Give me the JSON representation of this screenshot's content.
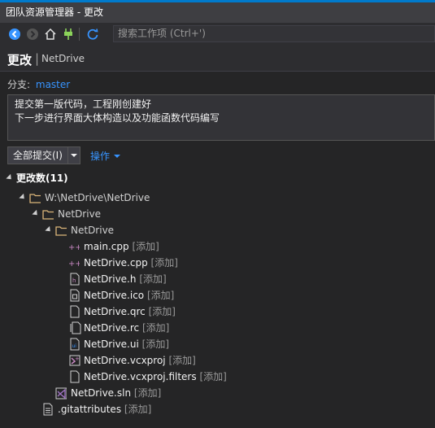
{
  "window": {
    "title": "团队资源管理器 - 更改"
  },
  "toolbar": {
    "search_placeholder": "搜索工作项 (Ctrl+')"
  },
  "header": {
    "title": "更改",
    "subtitle": "NetDrive"
  },
  "branch": {
    "label": "分支:",
    "name": "master"
  },
  "commit_message": {
    "line1": "提交第一版代码，工程刚创建好",
    "line2": "下一步进行界面大体构造以及功能函数代码编写"
  },
  "buttons": {
    "commit_all": "全部提交(I)",
    "actions": "操作"
  },
  "changes": {
    "section_label": "更改数(11)",
    "path": "W:\\NetDrive\\NetDrive",
    "folder1": "NetDrive",
    "folder2": "NetDrive",
    "files": [
      {
        "name": "main.cpp",
        "status": "[添加]",
        "icon": "cpp-add-icon"
      },
      {
        "name": "NetDrive.cpp",
        "status": "[添加]",
        "icon": "cpp-add-icon"
      },
      {
        "name": "NetDrive.h",
        "status": "[添加]",
        "icon": "header-file-icon"
      },
      {
        "name": "NetDrive.ico",
        "status": "[添加]",
        "icon": "ico-file-icon"
      },
      {
        "name": "NetDrive.qrc",
        "status": "[添加]",
        "icon": "file-icon"
      },
      {
        "name": "NetDrive.rc",
        "status": "[添加]",
        "icon": "rc-file-icon"
      },
      {
        "name": "NetDrive.ui",
        "status": "[添加]",
        "icon": "ui-file-icon"
      },
      {
        "name": "NetDrive.vcxproj",
        "status": "[添加]",
        "icon": "vcxproj-icon"
      },
      {
        "name": "NetDrive.vcxproj.filters",
        "status": "[添加]",
        "icon": "file-icon"
      }
    ],
    "sln": {
      "name": "NetDrive.sln",
      "status": "[添加]"
    },
    "gitattributes": {
      "name": ".gitattributes",
      "status": "[添加]"
    }
  }
}
